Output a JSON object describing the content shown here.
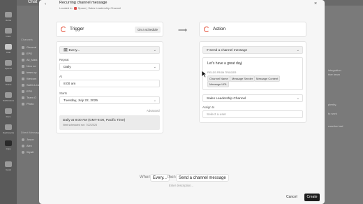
{
  "background": {
    "workspace_title": "Chat",
    "sidebar": [
      "Home",
      "Inbox",
      "Chat",
      "Spaces",
      "Teams",
      "Notifications",
      "Docs",
      "Dashboards",
      "Clips",
      "Goals",
      "Timesheets",
      "More"
    ],
    "channels_header": "Channels",
    "channels": [
      "General",
      "EPD",
      "All_Mark",
      "New ne",
      "team up",
      "Welcom",
      "Sales Lead",
      "EPD",
      "Team O",
      "Photo"
    ],
    "dm_header": "Direct Messages",
    "dms": [
      "Jason",
      "Alex",
      "Wyatt"
    ],
    "right_text": [
      "integration",
      "ther team",
      "plexity,",
      "to work",
      "roactive tasl"
    ]
  },
  "modal": {
    "title": "Recurring channel message",
    "subtitle_prefix": "Located in",
    "subtitle_path": "Space | Sales Leadership Channel",
    "trigger": {
      "label": "Trigger",
      "badge": "On a schedule",
      "every": "Every...",
      "repeat_label": "Repeat",
      "repeat_value": "Daily",
      "at_label": "At",
      "at_value": "8:00 am",
      "starts_label": "Starts",
      "starts_value": "Tuesday, July 22, 2025",
      "advanced": "Advanced",
      "summary_line1": "Daily at 8:00 AM (GMT-8:00, Pacific Time)",
      "summary_line2": "Next scheduled run: 7/22/2025"
    },
    "action": {
      "label": "Action",
      "action_type": "Send a channel message",
      "message_text": "Let's have a great day",
      "fields_label": "FIELDS FROM TRIGGER",
      "fields": [
        "Channel Name",
        "Message Sender",
        "Message Content",
        "Message URL"
      ],
      "channel": "Sales Leadership Channel",
      "assign_label": "Assign to",
      "assign_placeholder": "Select a user"
    },
    "footer": {
      "when": "When",
      "when_value": "Every...",
      "then": "then",
      "then_value": "Send a channel message",
      "description_placeholder": "Enter description...",
      "cancel": "Cancel",
      "create": "Create"
    }
  }
}
